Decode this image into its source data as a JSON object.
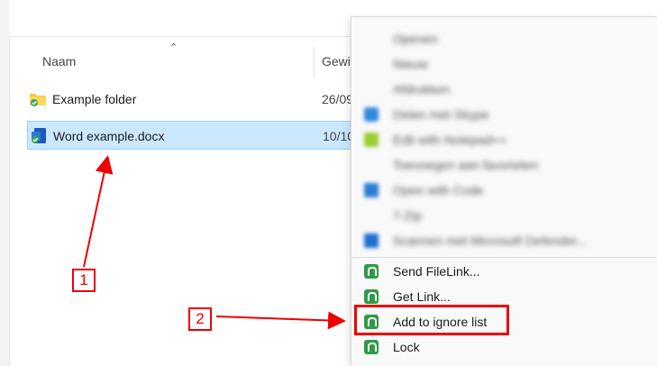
{
  "explorer": {
    "columns": {
      "name": "Naam",
      "date": "Gewi"
    },
    "rows": [
      {
        "name": "Example folder",
        "date": "26/09"
      },
      {
        "name": "Word example.docx",
        "date": "10/10"
      }
    ]
  },
  "annotations": {
    "callout_1": "1",
    "callout_2": "2"
  },
  "context_menu": {
    "blurred_items": [
      "Openen",
      "Nieuw",
      "Afdrukken",
      "Delen met Skype",
      "Edit with Notepad++",
      "Toevoegen aan favorieten",
      "Open with Code",
      "7-Zip",
      "Scannen met Microsoft Defender..."
    ],
    "items": [
      {
        "label": "Send FileLink...",
        "icon": "filelink-app-icon"
      },
      {
        "label": "Get Link...",
        "icon": "filelink-app-icon"
      },
      {
        "label": "Add to ignore list",
        "icon": "filelink-app-icon"
      },
      {
        "label": "Lock",
        "icon": "filelink-app-icon"
      }
    ]
  },
  "colors": {
    "selection": "#cce8ff",
    "annotation": "#e00000",
    "app_green": "#2f9a48"
  }
}
